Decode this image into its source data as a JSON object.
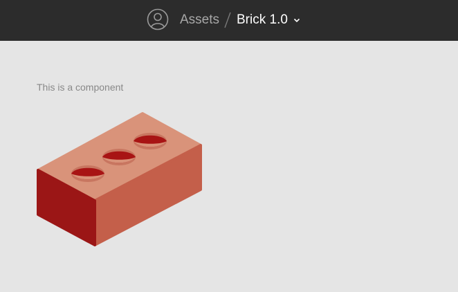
{
  "header": {
    "breadcrumb_parent": "Assets",
    "breadcrumb_separator": "/",
    "breadcrumb_current": "Brick 1.0",
    "avatar_icon": "user-circle-icon",
    "dropdown_icon": "chevron-down-icon"
  },
  "main": {
    "caption": "This is a component",
    "illustration": "brick-illustration",
    "colors": {
      "brick_top": "#d9937a",
      "brick_front": "#c45f4a",
      "brick_side": "#9b1616",
      "hole": "#a81414"
    }
  }
}
